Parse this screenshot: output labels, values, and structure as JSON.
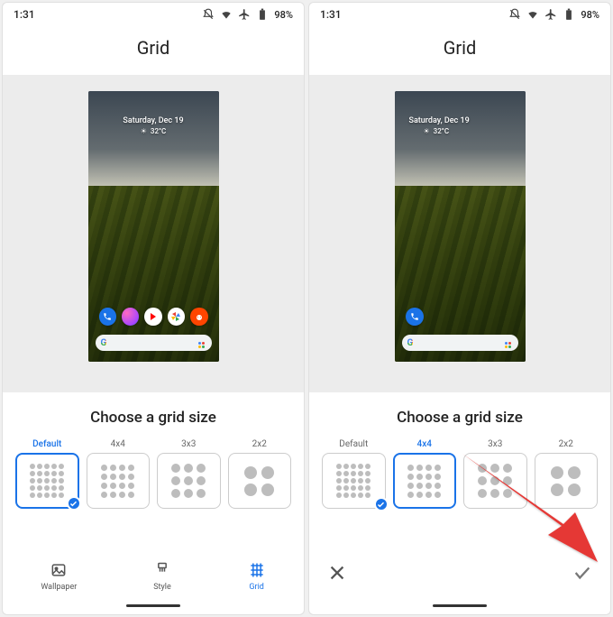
{
  "status": {
    "time": "1:31",
    "battery": "98%"
  },
  "title": "Grid",
  "preview": {
    "date": "Saturday, Dec 19",
    "temp": "32°C"
  },
  "chooser": {
    "heading": "Choose a grid size",
    "options": [
      "Default",
      "4x4",
      "3x3",
      "2x2"
    ]
  },
  "left_screen": {
    "selected_option_index": 0,
    "checked_option_index": 0,
    "dock_icons": 5,
    "nav": {
      "items": [
        "Wallpaper",
        "Style",
        "Grid"
      ],
      "active_index": 2
    }
  },
  "right_screen": {
    "selected_option_index": 1,
    "checked_option_index": 0,
    "dock_icons": 1,
    "confirm": {
      "cancel": "close",
      "apply": "check"
    }
  }
}
